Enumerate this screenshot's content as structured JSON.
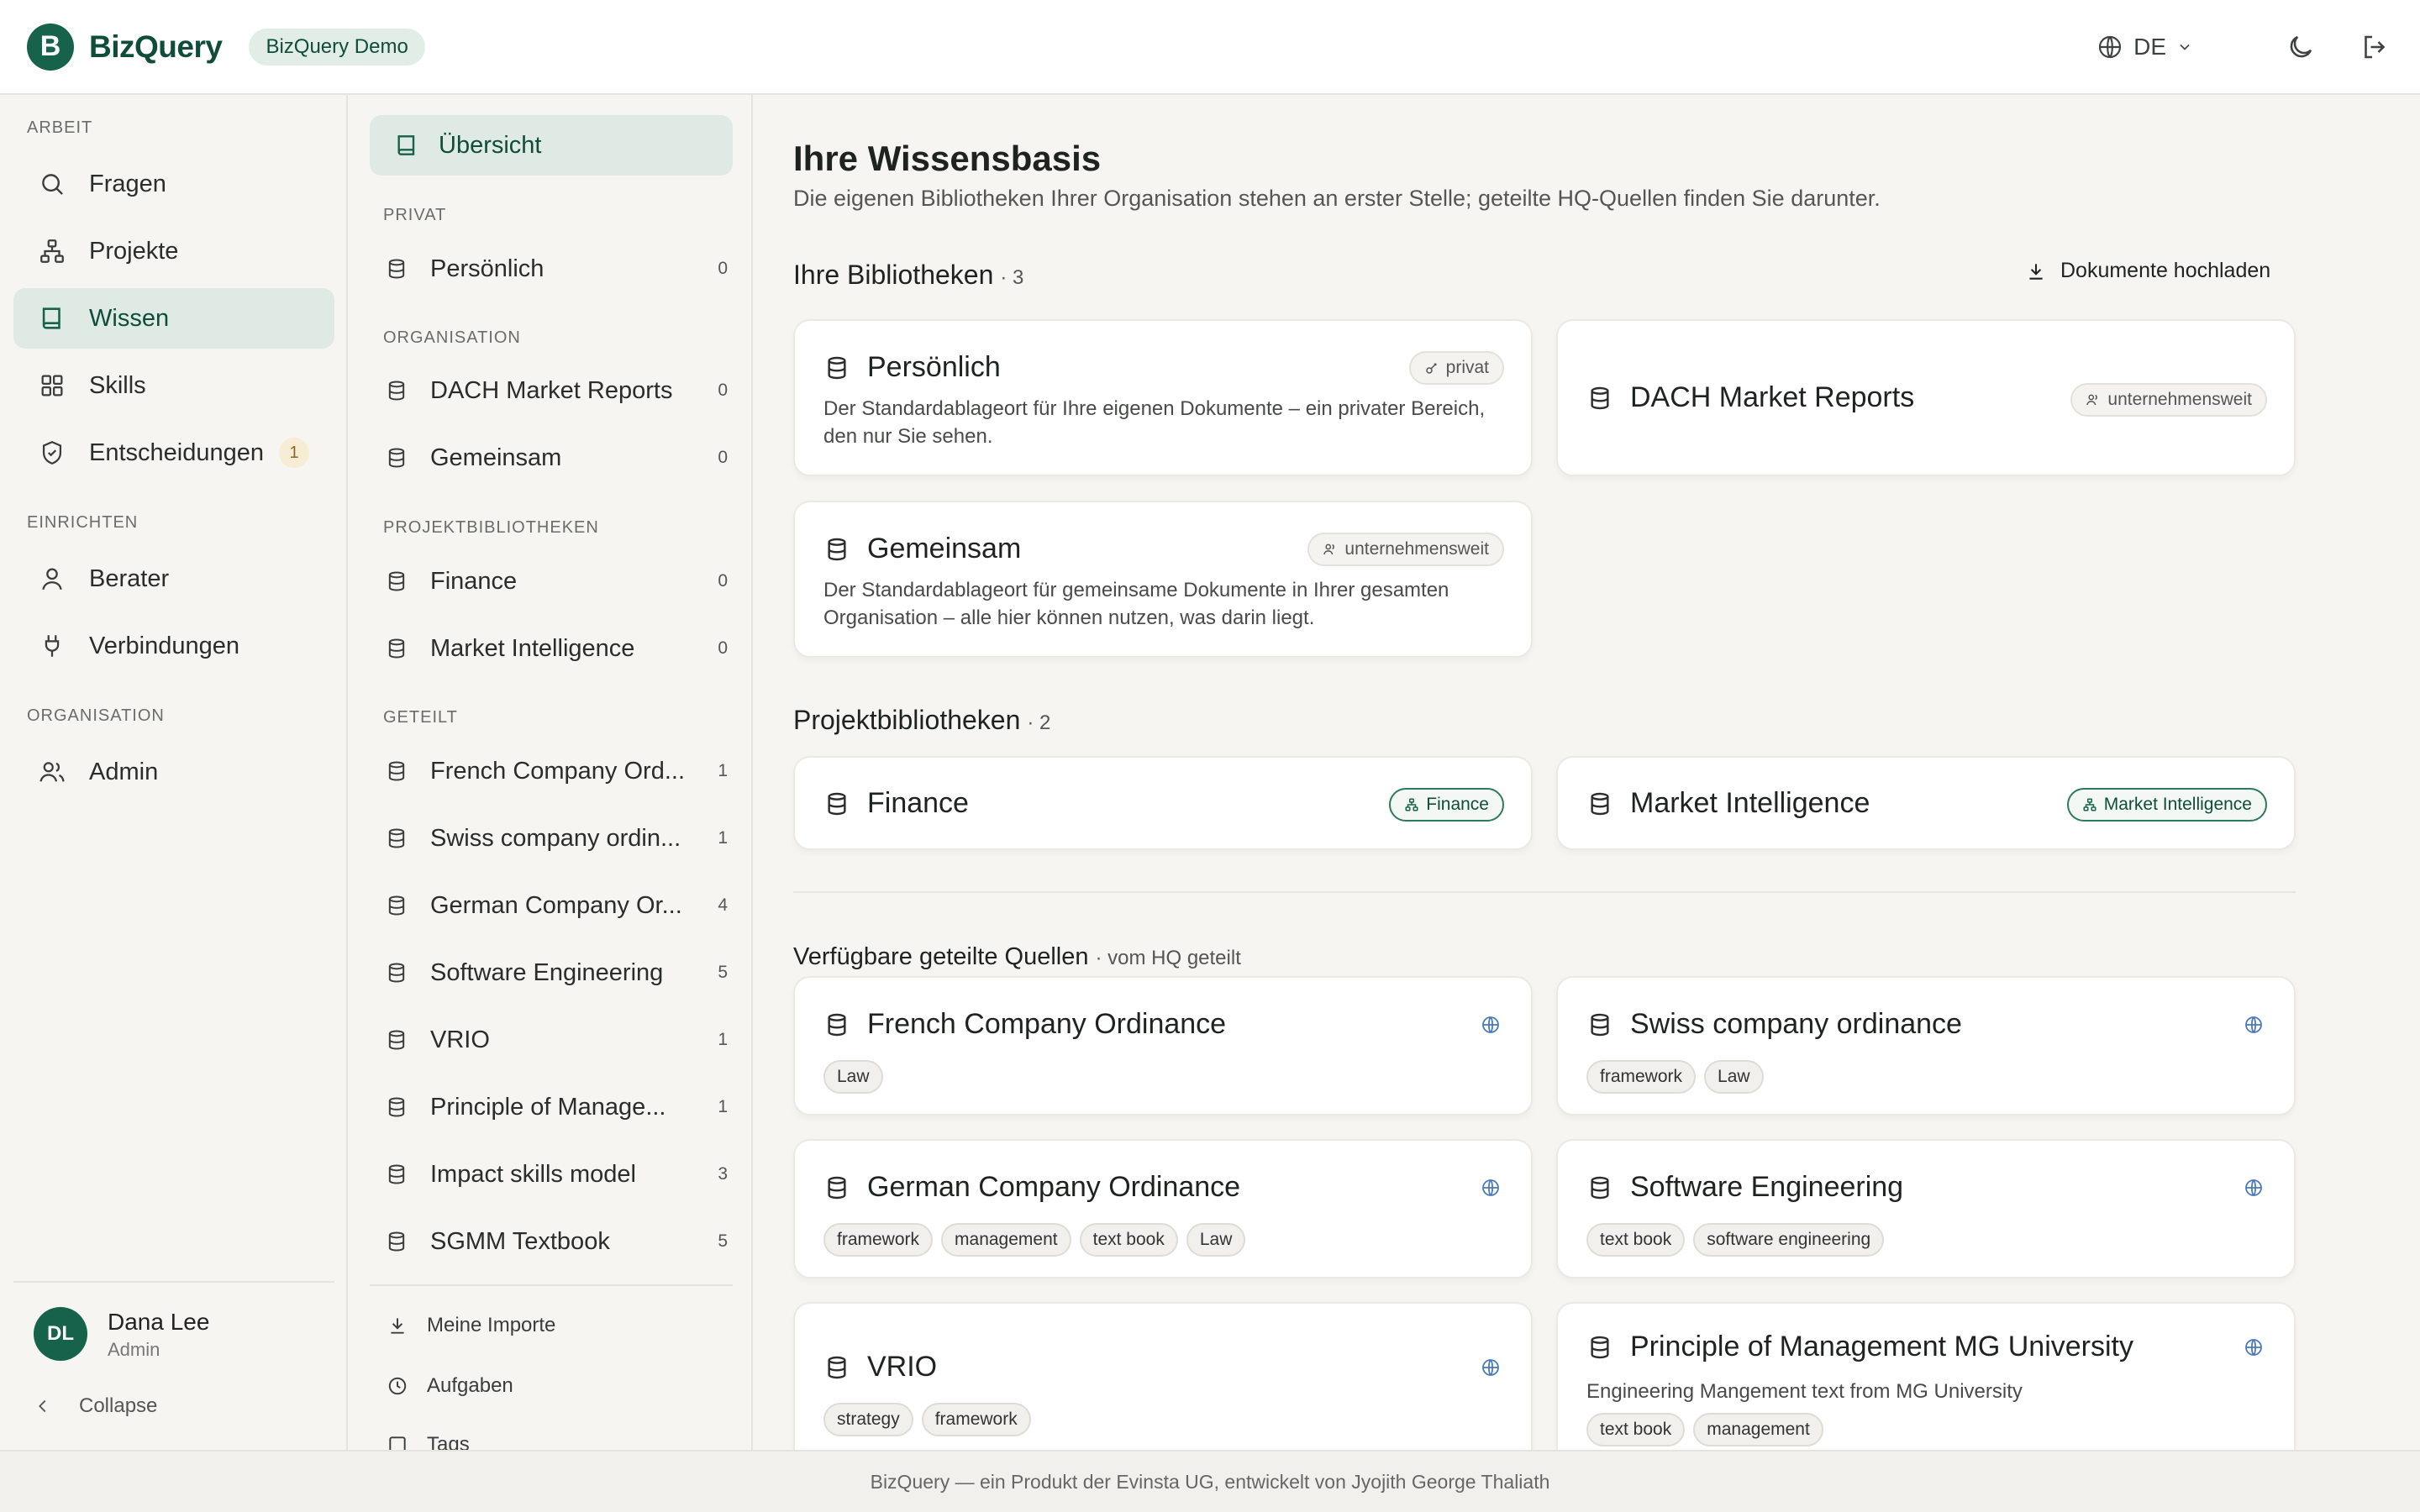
{
  "app": {
    "logo_letter": "B",
    "brand": "BizQuery",
    "demo_badge": "BizQuery Demo"
  },
  "header": {
    "language": "DE"
  },
  "nav": {
    "sections": {
      "work": "ARBEIT",
      "setup": "EINRICHTEN",
      "org": "ORGANISATION"
    },
    "items": [
      {
        "label": "Fragen"
      },
      {
        "label": "Projekte"
      },
      {
        "label": "Wissen"
      },
      {
        "label": "Skills"
      },
      {
        "label": "Entscheidungen",
        "count": "1"
      },
      {
        "label": "Berater"
      },
      {
        "label": "Verbindungen"
      },
      {
        "label": "Admin"
      }
    ],
    "user": {
      "initials": "DL",
      "name": "Dana Lee",
      "role": "Admin"
    },
    "collapse": "Collapse"
  },
  "libraries": {
    "overview": "Übersicht",
    "sections": {
      "private": "PRIVAT",
      "org": "ORGANISATION",
      "projects": "PROJEKTBIBLIOTHEKEN",
      "shared": "GETEILT"
    },
    "private": [
      {
        "label": "Persönlich",
        "count": "0"
      }
    ],
    "org": [
      {
        "label": "DACH Market Reports",
        "count": "0"
      },
      {
        "label": "Gemeinsam",
        "count": "0"
      }
    ],
    "projects": [
      {
        "label": "Finance",
        "count": "0"
      },
      {
        "label": "Market Intelligence",
        "count": "0"
      }
    ],
    "shared": [
      {
        "label": "French Company Ord...",
        "count": "1"
      },
      {
        "label": "Swiss company ordin...",
        "count": "1"
      },
      {
        "label": "German Company Or...",
        "count": "4"
      },
      {
        "label": "Software Engineering",
        "count": "5"
      },
      {
        "label": "VRIO",
        "count": "1"
      },
      {
        "label": "Principle of Manage...",
        "count": "1"
      },
      {
        "label": "Impact skills model",
        "count": "3"
      },
      {
        "label": "SGMM Textbook",
        "count": "5"
      }
    ],
    "footer": {
      "imports": "Meine Importe",
      "tasks": "Aufgaben",
      "tags": "Tags"
    }
  },
  "main": {
    "title": "Ihre Wissensbasis",
    "subtitle": "Die eigenen Bibliotheken Ihrer Organisation stehen an erster Stelle; geteilte HQ-Quellen finden Sie darunter.",
    "own": {
      "heading": "Ihre Bibliotheken",
      "count": "· 3",
      "upload": "Dokumente hochladen",
      "cards": [
        {
          "title": "Persönlich",
          "badge": "privat",
          "desc": "Der Standardablageort für Ihre eigenen Dokumente – ein privater Bereich, den nur Sie sehen."
        },
        {
          "title": "DACH Market Reports",
          "badge": "unternehmensweit"
        },
        {
          "title": "Gemeinsam",
          "badge": "unternehmensweit",
          "desc": "Der Standardablageort für gemeinsame Dokumente in Ihrer gesamten Organisation – alle hier können nutzen, was darin liegt."
        }
      ]
    },
    "projects": {
      "heading": "Projektbibliotheken",
      "count": "· 2",
      "cards": [
        {
          "title": "Finance",
          "badge": "Finance"
        },
        {
          "title": "Market Intelligence",
          "badge": "Market Intelligence"
        }
      ]
    },
    "shared": {
      "heading": "Verfügbare geteilte Quellen",
      "suffix": "· vom HQ geteilt",
      "cards": [
        {
          "title": "French Company Ordinance",
          "tags": [
            "Law"
          ]
        },
        {
          "title": "Swiss company ordinance",
          "tags": [
            "framework",
            "Law"
          ]
        },
        {
          "title": "German Company Ordinance",
          "tags": [
            "framework",
            "management",
            "text book",
            "Law"
          ]
        },
        {
          "title": "Software Engineering",
          "tags": [
            "text book",
            "software engineering"
          ]
        },
        {
          "title": "VRIO",
          "tags": [
            "strategy",
            "framework"
          ]
        },
        {
          "title": "Principle of Management MG University",
          "desc": "Engineering Mangement text from MG University",
          "tags": [
            "text book",
            "management"
          ]
        }
      ]
    }
  },
  "footer": {
    "text": "BizQuery — ein Produkt der Evinsta UG, entwickelt von Jyojith George Thaliath"
  },
  "colors": {
    "accent": "#17624a",
    "accent_soft": "#e3ede8",
    "badge_warn": "#f7ecd4"
  }
}
